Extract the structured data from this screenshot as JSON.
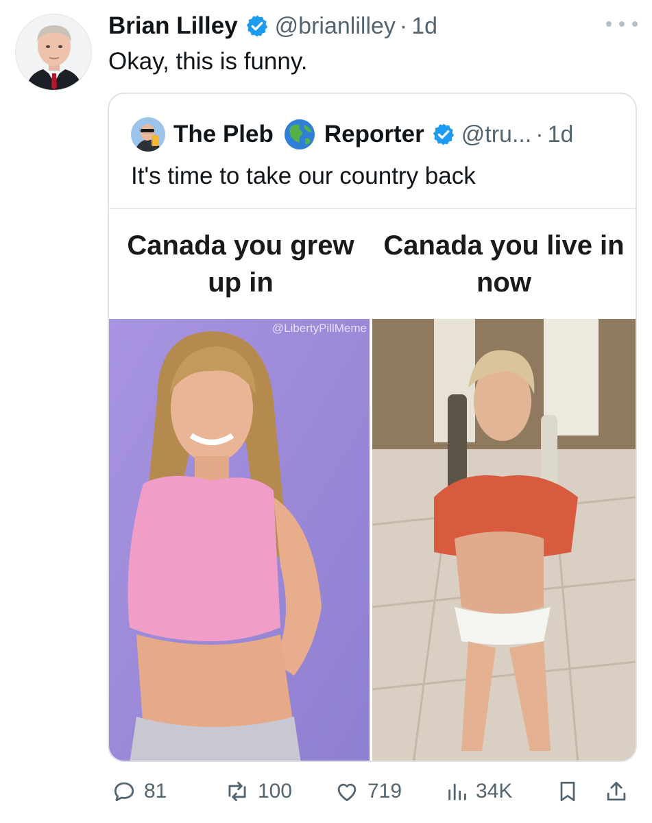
{
  "post": {
    "author_name": "Brian Lilley",
    "author_handle": "@brianlilley",
    "separator": "·",
    "time": "1d",
    "text": "Okay, this is funny."
  },
  "quote": {
    "name_part1": "The Pleb",
    "name_part2": "Reporter",
    "handle": "@tru...",
    "separator": "·",
    "time": "1d",
    "text": "It's time to take our country back"
  },
  "meme": {
    "left_caption": "Canada you grew up in",
    "right_caption": "Canada you live in now",
    "watermark": "@LibertyPillMeme"
  },
  "actions": {
    "replies": "81",
    "reposts": "100",
    "likes": "719",
    "views": "34K"
  },
  "icons": {
    "verified": "verified-badge-icon",
    "globe": "globe-icon",
    "more": "more-icon",
    "reply": "reply-icon",
    "repost": "repost-icon",
    "like": "like-icon",
    "views": "views-icon",
    "bookmark": "bookmark-icon",
    "share": "share-icon"
  },
  "colors": {
    "verified_blue": "#1d9bf0",
    "secondary_text": "#536471",
    "primary_text": "#0f1419"
  }
}
